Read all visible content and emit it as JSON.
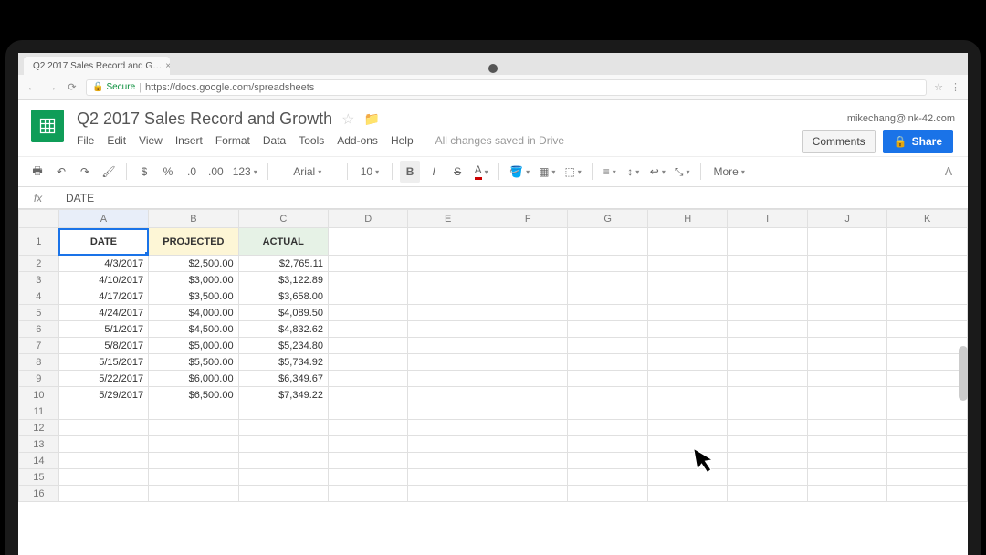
{
  "browser": {
    "tab_title": "Q2 2017 Sales Record and G…",
    "secure_label": "Secure",
    "url": "https://docs.google.com/spreadsheets"
  },
  "doc": {
    "title": "Q2 2017 Sales Record and Growth",
    "user_email": "mikechang@ink-42.com",
    "save_status": "All changes saved in Drive",
    "comments_label": "Comments",
    "share_label": "Share"
  },
  "menus": [
    "File",
    "Edit",
    "View",
    "Insert",
    "Format",
    "Data",
    "Tools",
    "Add-ons",
    "Help"
  ],
  "toolbar": {
    "font": "Arial",
    "font_size": "10",
    "num_format": "123",
    "more_label": "More"
  },
  "formula_bar": {
    "fx": "fx",
    "value": "DATE"
  },
  "columns": [
    "A",
    "B",
    "C",
    "D",
    "E",
    "F",
    "G",
    "H",
    "I",
    "J",
    "K"
  ],
  "row_numbers": [
    1,
    2,
    3,
    4,
    5,
    6,
    7,
    8,
    9,
    10,
    11,
    12,
    13,
    14,
    15,
    16
  ],
  "headers": {
    "A": "DATE",
    "B": "PROJECTED",
    "C": "ACTUAL"
  },
  "rows": [
    {
      "date": "4/3/2017",
      "projected": "$2,500.00",
      "actual": "$2,765.11"
    },
    {
      "date": "4/10/2017",
      "projected": "$3,000.00",
      "actual": "$3,122.89"
    },
    {
      "date": "4/17/2017",
      "projected": "$3,500.00",
      "actual": "$3,658.00"
    },
    {
      "date": "4/24/2017",
      "projected": "$4,000.00",
      "actual": "$4,089.50"
    },
    {
      "date": "5/1/2017",
      "projected": "$4,500.00",
      "actual": "$4,832.62"
    },
    {
      "date": "5/8/2017",
      "projected": "$5,000.00",
      "actual": "$5,234.80"
    },
    {
      "date": "5/15/2017",
      "projected": "$5,500.00",
      "actual": "$5,734.92"
    },
    {
      "date": "5/22/2017",
      "projected": "$6,000.00",
      "actual": "$6,349.67"
    },
    {
      "date": "5/29/2017",
      "projected": "$6,500.00",
      "actual": "$7,349.22"
    }
  ],
  "chart_data": {
    "type": "table",
    "title": "Q2 2017 Sales Record and Growth",
    "columns": [
      "DATE",
      "PROJECTED",
      "ACTUAL"
    ],
    "series": [
      {
        "name": "PROJECTED",
        "values": [
          2500,
          3000,
          3500,
          4000,
          4500,
          5000,
          5500,
          6000,
          6500
        ]
      },
      {
        "name": "ACTUAL",
        "values": [
          2765.11,
          3122.89,
          3658.0,
          4089.5,
          4832.62,
          5234.8,
          5734.92,
          6349.67,
          7349.22
        ]
      }
    ],
    "x": [
      "4/3/2017",
      "4/10/2017",
      "4/17/2017",
      "4/24/2017",
      "5/1/2017",
      "5/8/2017",
      "5/15/2017",
      "5/22/2017",
      "5/29/2017"
    ]
  }
}
